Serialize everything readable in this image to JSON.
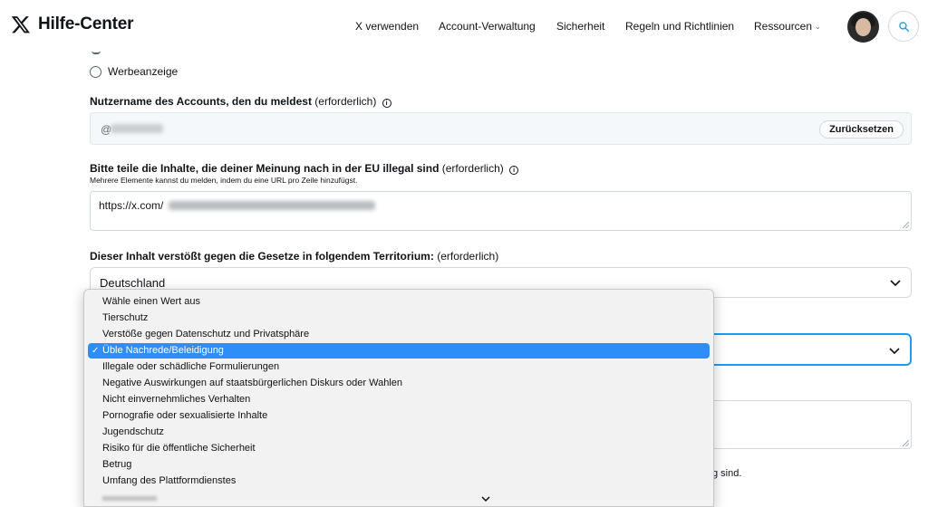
{
  "header": {
    "brand": "Hilfe-Center",
    "nav": [
      {
        "label": "X verwenden"
      },
      {
        "label": "Account-Verwaltung"
      },
      {
        "label": "Sicherheit"
      },
      {
        "label": "Regeln und Richtlinien"
      },
      {
        "label": "Ressourcen"
      }
    ]
  },
  "form": {
    "radio_option": "Werbeanzeige",
    "username_label": "Nutzername des Accounts, den du meldest",
    "required_suffix": "(erforderlich)",
    "username_prefix": "@",
    "reset_label": "Zurücksetzen",
    "content_label": "Bitte teile die Inhalte, die deiner Meinung nach in der EU illegal sind",
    "content_hint": "Mehrere Elemente kannst du melden, indem du eine URL pro Zeile hinzufügst.",
    "content_value_prefix": "https://x.com/",
    "territory_label": "Dieser Inhalt verstößt gegen die Gesetze in folgendem Territorium:",
    "territory_value": "Deutschland",
    "tail_text": "g sind."
  },
  "dropdown": {
    "selected_index": 3,
    "options": [
      "Wähle einen Wert aus",
      "Tierschutz",
      "Verstöße gegen Datenschutz und Privatsphäre",
      "Üble Nachrede/Beleidigung",
      "Illegale oder schädliche Formulierungen",
      "Negative Auswirkungen auf staatsbürgerlichen Diskurs oder Wahlen",
      "Nicht einvernehmliches Verhalten",
      "Pornografie oder sexualisierte Inhalte",
      "Jugendschutz",
      "Risiko für die öffentliche Sicherheit",
      "Betrug",
      "Umfang des Plattformdienstes"
    ],
    "check_glyph": "✓"
  },
  "colors": {
    "accent": "#1d9bf0",
    "selection": "#2e8df6"
  },
  "icons": [
    "x-logo-icon",
    "chevron-down-icon",
    "search-icon",
    "info-icon",
    "resize-grip-icon"
  ]
}
